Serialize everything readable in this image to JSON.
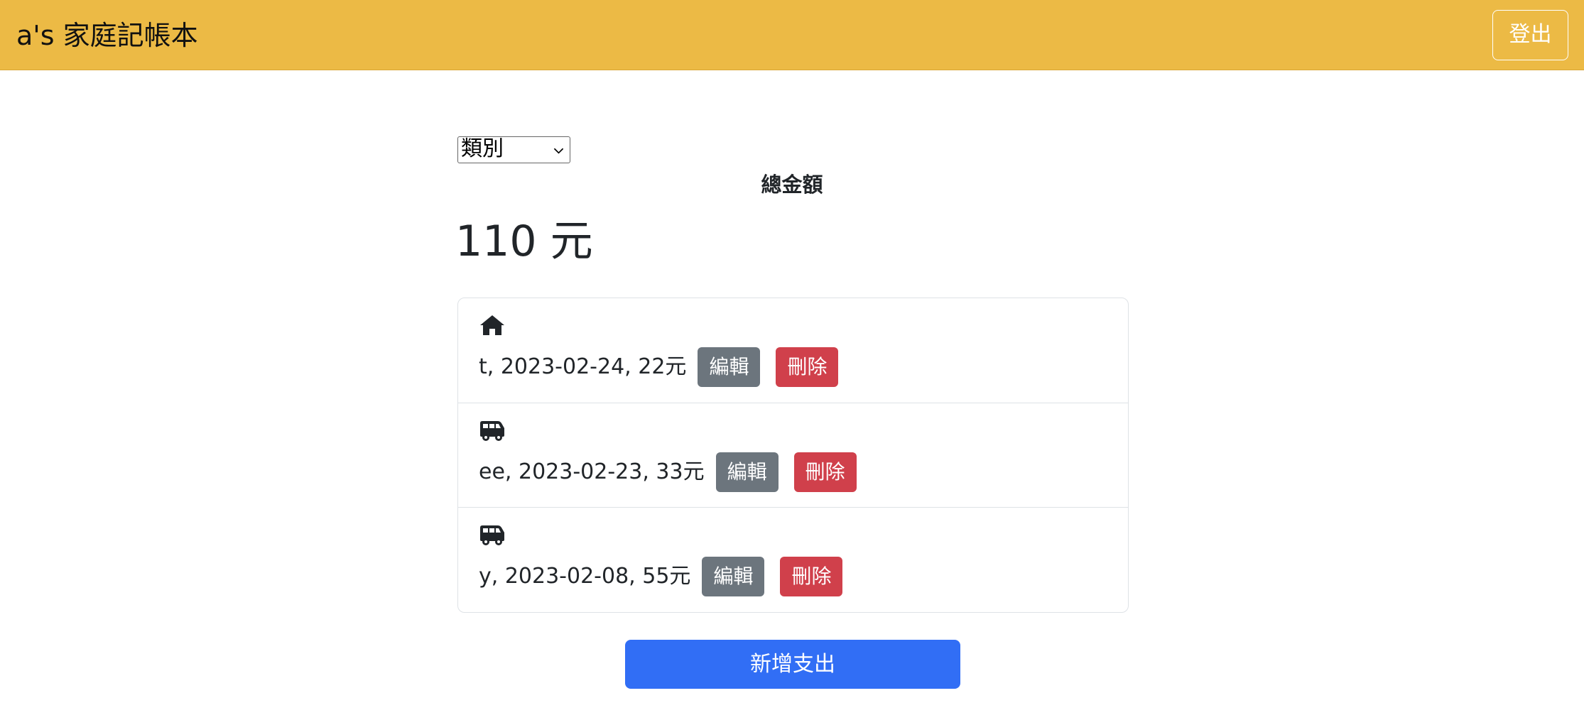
{
  "header": {
    "brand": "a's 家庭記帳本",
    "logout_label": "登出"
  },
  "filter": {
    "category_selected": "類別"
  },
  "summary": {
    "total_label": "總金額",
    "total_value": "110 元"
  },
  "expenses": [
    {
      "icon": "home-icon",
      "text": "t, 2023-02-24, 22元",
      "edit_label": "編輯",
      "delete_label": "刪除"
    },
    {
      "icon": "van-icon",
      "text": "ee, 2023-02-23, 33元",
      "edit_label": "編輯",
      "delete_label": "刪除"
    },
    {
      "icon": "van-icon",
      "text": "y, 2023-02-08, 55元",
      "edit_label": "編輯",
      "delete_label": "刪除"
    }
  ],
  "actions": {
    "add_expense_label": "新增支出"
  },
  "colors": {
    "header_bg": "#ecba45",
    "edit_button": "#6c757d",
    "delete_button": "#d0404b",
    "primary_button": "#316ef5"
  }
}
